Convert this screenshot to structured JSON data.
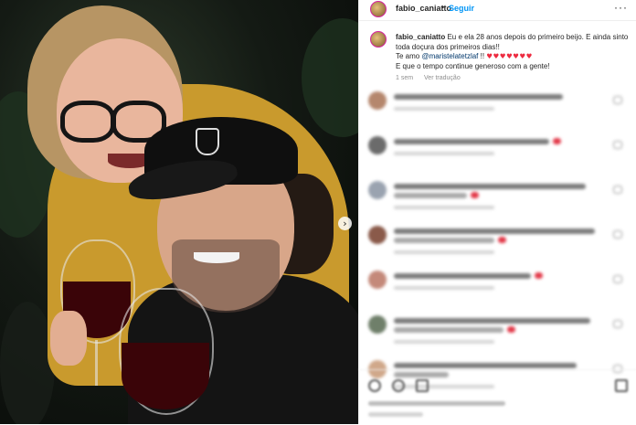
{
  "post": {
    "photo_alt": "",
    "next_icon": "chevron-right-icon",
    "next_glyph": "›"
  },
  "header": {
    "username": "fabio_caniatto",
    "separator": "•",
    "follow_label": "Seguir",
    "more_glyph": "···"
  },
  "caption": {
    "username": "fabio_caniatto",
    "line1": "Eu e ela 28 anos depois do primeiro beijo. E ainda sinto toda doçura dos primeiros dias!!",
    "line2_prefix": "Te amo ",
    "mention": "@maristelatetzlaf",
    "line2_suffix": " !! ",
    "hearts": "♥♥♥♥♥♥♥",
    "line3": "E que o tempo continue generoso com a gente!",
    "time": "1 sem",
    "translate": "Ver tradução"
  },
  "colors": {
    "accent": "#0095f6",
    "mention": "#00376b",
    "heart": "#ed2b40",
    "meta": "#8e8e8e"
  },
  "comments": [
    {
      "avatar_color": "#b5876d",
      "l1": 185,
      "l2": 0,
      "heart": false
    },
    {
      "avatar_color": "#6b6b6b",
      "l1": 170,
      "l2": 0,
      "heart": true
    },
    {
      "avatar_color": "#9aa3b0",
      "l1": 210,
      "l2": 80,
      "heart": true
    },
    {
      "avatar_color": "#8a5a4a",
      "l1": 220,
      "l2": 110,
      "heart": true
    },
    {
      "avatar_color": "#c4897a",
      "l1": 150,
      "l2": 0,
      "heart": true
    },
    {
      "avatar_color": "#6f7f6a",
      "l1": 215,
      "l2": 120,
      "heart": true
    },
    {
      "avatar_color": "#d0a88a",
      "l1": 200,
      "l2": 60,
      "heart": false
    }
  ]
}
